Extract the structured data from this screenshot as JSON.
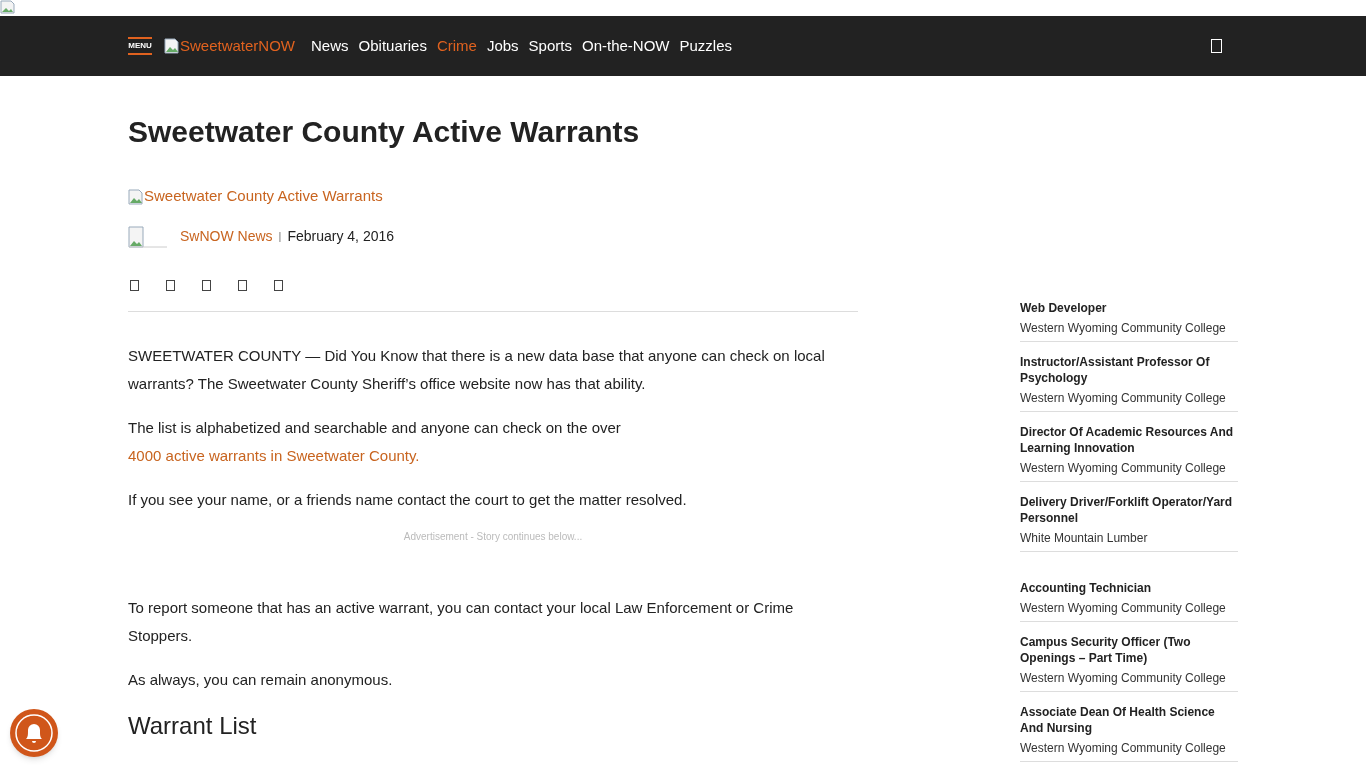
{
  "nav": {
    "menu_label": "MENU",
    "logo_alt": "SweetwaterNOW",
    "links": [
      {
        "label": "News",
        "selected": false
      },
      {
        "label": "Obituaries",
        "selected": false
      },
      {
        "label": "Crime",
        "selected": true
      },
      {
        "label": "Jobs",
        "selected": false
      },
      {
        "label": "Sports",
        "selected": false
      },
      {
        "label": "On-the-NOW",
        "selected": false
      },
      {
        "label": "Puzzles",
        "selected": false
      }
    ]
  },
  "article": {
    "title": "Sweetwater County Active Warrants",
    "image_alt": "Sweetwater County Active Warrants",
    "author": "SwNOW News",
    "separator": "|",
    "date": "February 4, 2016",
    "paragraphs": [
      {
        "kind": "text",
        "text": "SWEETWATER COUNTY — Did You Know that there is a new data base that anyone can check on local warrants? The Sweetwater County Sheriff’s office website now has that ability."
      },
      {
        "kind": "link",
        "text": "The list is alphabetized and searchable and anyone can check on the over ",
        "link": "4000 active warrants in Sweetwater County."
      },
      {
        "kind": "text",
        "text": "If you see your name, or a friends name contact the court to get the matter resolved."
      },
      {
        "kind": "ad",
        "text": "Advertisement - Story continues below..."
      },
      {
        "kind": "text",
        "text": "To report someone that has an active warrant, you can contact your local Law Enforcement or Crime Stoppers."
      },
      {
        "kind": "text",
        "text": "As always, you can remain anonymous."
      },
      {
        "kind": "heading",
        "text": "Warrant List"
      }
    ]
  },
  "jobs": [
    {
      "title": "Web Developer",
      "company": "Western Wyoming Community College"
    },
    {
      "title": "Instructor/Assistant Professor Of Psychology",
      "company": "Western Wyoming Community College"
    },
    {
      "title": "Director Of Academic Resources And Learning Innovation",
      "company": "Western Wyoming Community College"
    },
    {
      "title": "Delivery Driver/Forklift Operator/Yard Personnel",
      "company": "White Mountain Lumber"
    },
    {
      "title": "Accounting Technician",
      "company": "Western Wyoming Community College"
    },
    {
      "title": "Campus Security Officer (Two Openings – Part Time)",
      "company": "Western Wyoming Community College"
    },
    {
      "title": "Associate Dean Of Health Science And Nursing",
      "company": "Western Wyoming Community College"
    }
  ]
}
